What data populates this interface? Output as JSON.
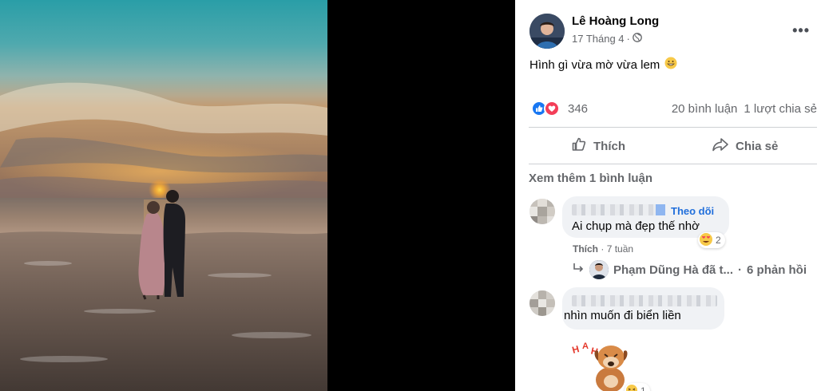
{
  "post": {
    "author": "Lê Hoàng Long",
    "date": "17 Tháng 4",
    "meta_sep": "·",
    "audience_icon": "globe-icon",
    "more_icon": "more-horizontal-icon",
    "more_glyph": "•••",
    "text": "Hình gì vừa mờ vừa lem",
    "text_emoji": "grinning-face-emoji"
  },
  "stats": {
    "reaction_icons": [
      "like-icon",
      "love-icon"
    ],
    "reaction_count": "346",
    "comment_count": "20 bình luận",
    "share_count": "1 lượt chia sẻ"
  },
  "actions": {
    "like_label": "Thích",
    "share_label": "Chia sẻ"
  },
  "comments": {
    "see_more": "Xem thêm 1 bình luận",
    "items": [
      {
        "follow_label": "Theo dõi",
        "text": "Ai chụp mà đẹp thế nhờ",
        "reaction_icon": "haha-heart-eyes-icon",
        "reaction_count": "2",
        "like_label": "Thích",
        "time_sep": "·",
        "time": "7 tuần",
        "reply_icon": "reply-arrow-icon",
        "reply_user": "Phạm Dũng Hà đã t...",
        "reply_sep": "·",
        "reply_count": "6 phản hồi"
      },
      {
        "text": "nhìn muốn đi biển liền",
        "sticker_icon": "dog-sticker",
        "reaction_count": "1"
      }
    ]
  },
  "colors": {
    "link_blue": "#216fdb",
    "secondary_text": "#65676b",
    "bubble_bg": "#f0f2f5",
    "like_blue": "#1877f2",
    "love_red": "#f33e58"
  }
}
